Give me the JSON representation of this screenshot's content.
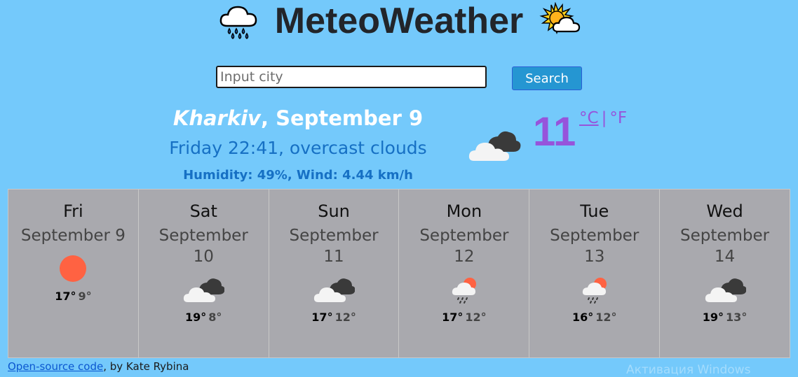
{
  "app": {
    "title": "MeteoWeather",
    "left_icon": "cloud-rain-icon",
    "right_icon": "sun-behind-cloud-icon"
  },
  "search": {
    "placeholder": "Input city",
    "value": "",
    "button_label": "Search"
  },
  "current": {
    "city": "Kharkiv",
    "date": ", September 9",
    "day_time_desc": "Friday 22:41, overcast clouds",
    "details": "Humidity: 49%, Wind: 4.44 km/h",
    "temperature": "11",
    "icon": "overcast-clouds-icon",
    "unit_c": "°C",
    "unit_sep": "|",
    "unit_f": "°F"
  },
  "forecast": [
    {
      "day": "Fri",
      "date": "September 9",
      "icon": "sun-icon",
      "max": "17°",
      "min": "9°"
    },
    {
      "day": "Sat",
      "date": "September 10",
      "icon": "overcast-clouds-icon",
      "max": "19°",
      "min": "8°"
    },
    {
      "day": "Sun",
      "date": "September 11",
      "icon": "overcast-clouds-icon",
      "max": "17°",
      "min": "12°"
    },
    {
      "day": "Mon",
      "date": "September 12",
      "icon": "sun-cloud-rain-icon",
      "max": "17°",
      "min": "12°"
    },
    {
      "day": "Tue",
      "date": "September 13",
      "icon": "sun-cloud-rain-icon",
      "max": "16°",
      "min": "12°"
    },
    {
      "day": "Wed",
      "date": "September 14",
      "icon": "overcast-clouds-icon",
      "max": "19°",
      "min": "13°"
    }
  ],
  "footer": {
    "link_text": "Open-source code",
    "author_text": ", by Kate Rybina"
  },
  "watermark": "Активация Windows",
  "colors": {
    "background": "#74c9fb",
    "forecast_card": "#a9a9ae",
    "temperature": "#9654db",
    "description": "#1670c4",
    "search_button": "#2596d2",
    "sun": "#ff6242"
  }
}
